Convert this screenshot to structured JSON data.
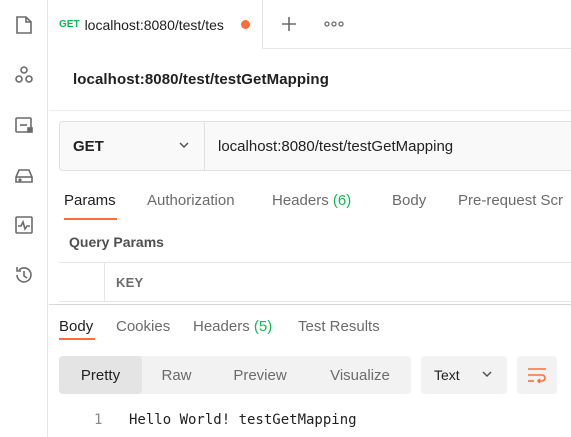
{
  "sidebar": {
    "icons": [
      "collections-icon",
      "apis-icon",
      "environments-icon",
      "mock-servers-icon",
      "monitors-icon",
      "history-icon"
    ]
  },
  "tabs": {
    "request_tab": {
      "method": "GET",
      "name": "localhost:8080/test/tes"
    },
    "unsaved_color": "#ff6c37"
  },
  "request": {
    "title": "localhost:8080/test/testGetMapping",
    "method": "GET",
    "url": "localhost:8080/test/testGetMapping"
  },
  "request_tabs": [
    {
      "label": "Params"
    },
    {
      "label": "Authorization"
    },
    {
      "label": "Headers",
      "count": "(6)"
    },
    {
      "label": "Body"
    },
    {
      "label": "Pre-request Scr"
    }
  ],
  "query_params": {
    "title": "Query Params",
    "key_header": "KEY"
  },
  "response_tabs": [
    {
      "label": "Body"
    },
    {
      "label": "Cookies"
    },
    {
      "label": "Headers",
      "count": "(5)"
    },
    {
      "label": "Test Results"
    }
  ],
  "body_view": {
    "modes": [
      "Pretty",
      "Raw",
      "Preview",
      "Visualize"
    ],
    "format": "Text"
  },
  "response_body": {
    "lines": [
      {
        "number": "1",
        "text": "Hello World! testGetMapping"
      }
    ]
  },
  "colors": {
    "accent": "#ff6c37",
    "get_method": "#0cbb52"
  }
}
